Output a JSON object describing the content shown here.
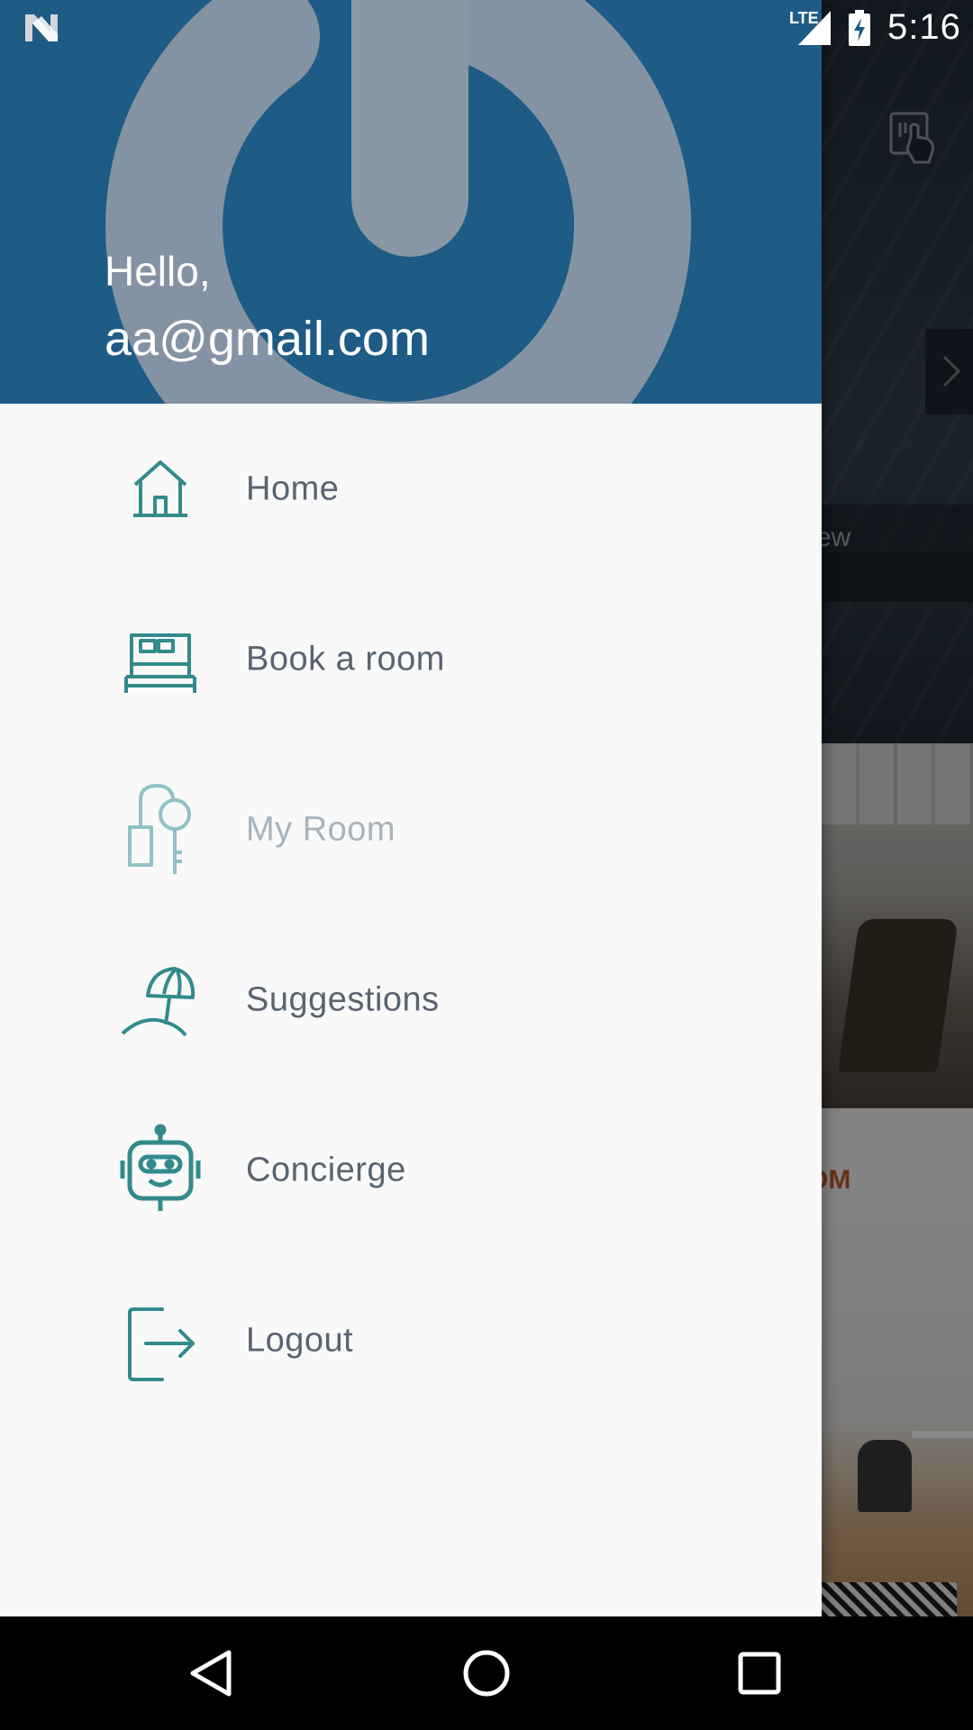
{
  "status_bar": {
    "network": "LTE",
    "time": "5:16"
  },
  "drawer": {
    "greeting": "Hello,",
    "email": "aa@gmail.com",
    "items": [
      {
        "label": "Home",
        "icon": "home-icon",
        "enabled": true
      },
      {
        "label": "Book a room",
        "icon": "bed-icon",
        "enabled": true
      },
      {
        "label": "My Room",
        "icon": "room-key-icon",
        "enabled": false
      },
      {
        "label": "Suggestions",
        "icon": "beach-umbrella-icon",
        "enabled": true
      },
      {
        "label": "Concierge",
        "icon": "robot-icon",
        "enabled": true
      },
      {
        "label": "Logout",
        "icon": "logout-icon",
        "enabled": true
      }
    ]
  },
  "background": {
    "partial_view_text": "ew",
    "partial_label_text": "OM"
  },
  "colors": {
    "header_blue": "#1e5b85",
    "icon_teal": "#338a8c",
    "label_gray": "#5a6470",
    "disabled_gray": "#a8b3bb",
    "accent_orange": "#c0582a"
  },
  "nav_bar": {
    "back": "back-icon",
    "home": "home-circle-icon",
    "recents": "recents-icon"
  }
}
